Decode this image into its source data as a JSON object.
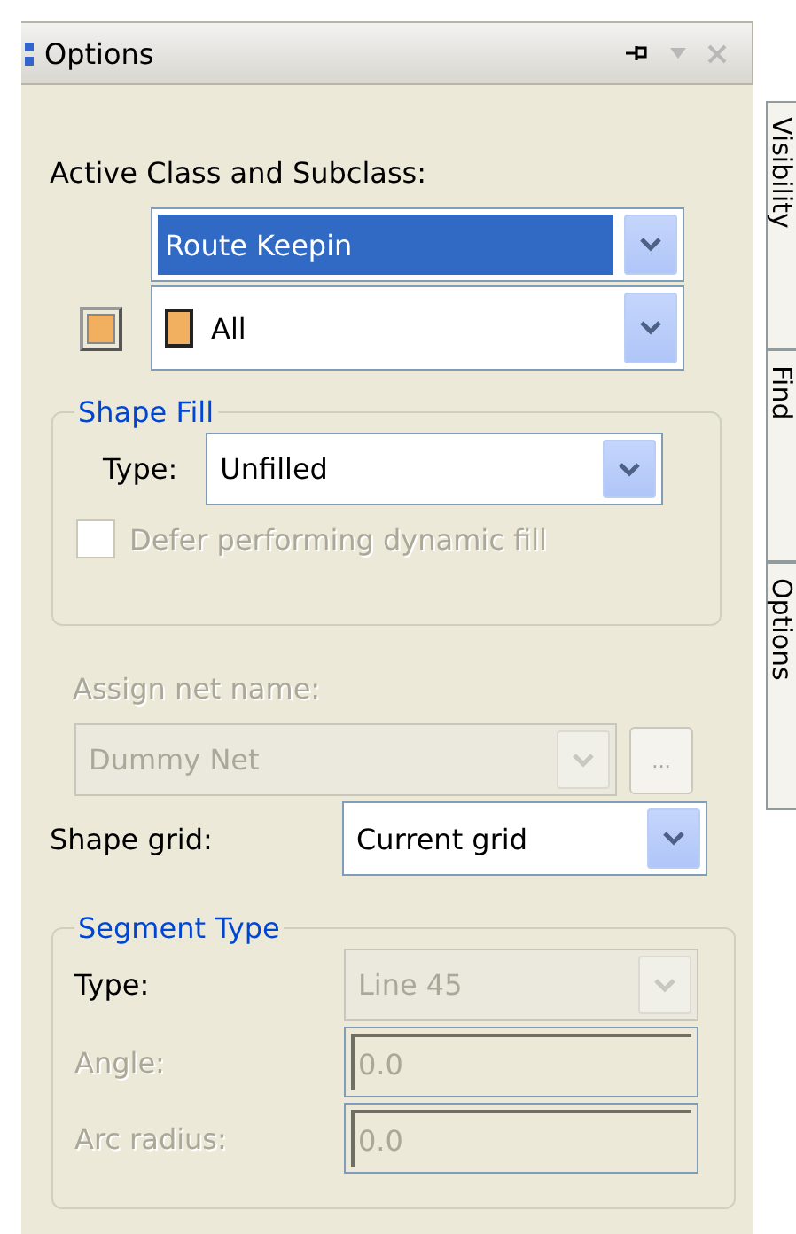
{
  "panel": {
    "title": "Options",
    "buttons": [
      {
        "kind": "pin",
        "disabled": false
      },
      {
        "kind": "menu",
        "disabled": true
      },
      {
        "kind": "close",
        "disabled": true
      }
    ]
  },
  "side_tabs": [
    {
      "label": "Visibility"
    },
    {
      "label": "Find"
    },
    {
      "label": "Options"
    }
  ],
  "active_class": {
    "label": "Active Class and Subclass:",
    "class": {
      "value": "Route Keepin",
      "highlighted": true
    },
    "subclass": {
      "value": "All",
      "color": "#f0b060"
    }
  },
  "shape_fill": {
    "title": "Shape Fill",
    "type_label": "Type:",
    "type_value": "Unfilled",
    "defer": {
      "label": "Defer performing dynamic fill",
      "checked": false,
      "disabled": true
    }
  },
  "net_name": {
    "label": "Assign net name:",
    "value": "Dummy Net",
    "disabled": true,
    "browse": "..."
  },
  "shape_grid": {
    "label": "Shape grid:",
    "value": "Current grid",
    "disabled": false
  },
  "segment_type": {
    "title": "Segment Type",
    "fields": [
      {
        "kind": "dropdown",
        "label": "Type:",
        "value": "Line 45",
        "label_disabled": false,
        "disabled": true
      },
      {
        "kind": "text",
        "label": "Angle:",
        "value": "0.0",
        "label_disabled": true,
        "disabled": true
      },
      {
        "kind": "text",
        "label": "Arc radius:",
        "value": "0.0",
        "label_disabled": true,
        "disabled": true
      }
    ]
  }
}
